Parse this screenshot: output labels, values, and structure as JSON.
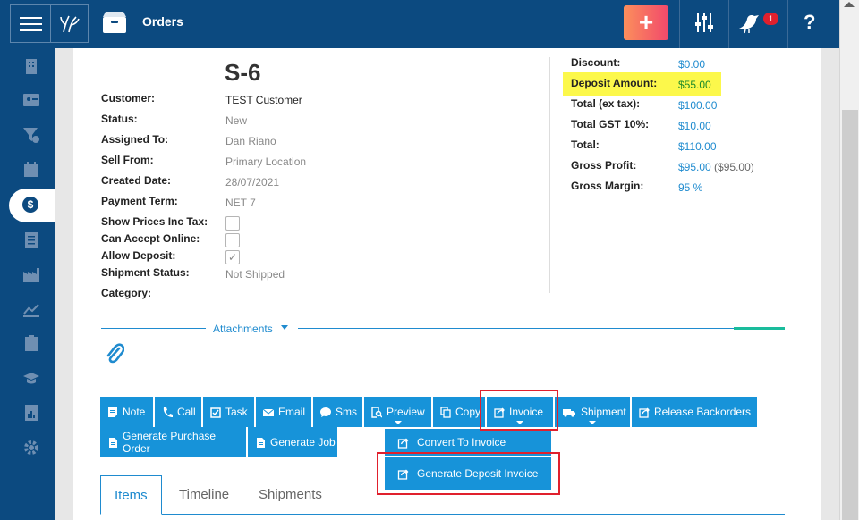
{
  "topbar": {
    "module_title": "Orders",
    "plus_label": "+",
    "notification_count": "1",
    "help_label": "?"
  },
  "order": {
    "number": "S-6",
    "fields": [
      {
        "label": "Customer:",
        "value": "TEST Customer"
      },
      {
        "label": "Status:",
        "value": "New"
      },
      {
        "label": "Assigned To:",
        "value": "Dan Riano"
      },
      {
        "label": "Sell From:",
        "value": "Primary Location"
      },
      {
        "label": "Created Date:",
        "value": "28/07/2021"
      },
      {
        "label": "Payment Term:",
        "value": "NET 7"
      },
      {
        "label": "Show Prices Inc Tax:",
        "value": ""
      },
      {
        "label": "Can Accept Online:",
        "value": ""
      },
      {
        "label": "Allow Deposit:",
        "value": ""
      },
      {
        "label": "Shipment Status:",
        "value": "Not Shipped"
      },
      {
        "label": "Category:",
        "value": ""
      }
    ],
    "checkboxes": {
      "show_prices_inc_tax": false,
      "can_accept_online": false,
      "allow_deposit": true
    }
  },
  "summary": [
    {
      "label": "Discount:",
      "value": "$0.00",
      "extra": ""
    },
    {
      "label": "Deposit Amount:",
      "value": "$55.00",
      "extra": ""
    },
    {
      "label": "Total (ex tax):",
      "value": "$100.00",
      "extra": ""
    },
    {
      "label": "Total GST 10%:",
      "value": "$10.00",
      "extra": ""
    },
    {
      "label": "Total:",
      "value": "$110.00",
      "extra": ""
    },
    {
      "label": "Gross Profit:",
      "value": "$95.00",
      "extra": "($95.00)"
    },
    {
      "label": "Gross Margin:",
      "value": "95 %",
      "extra": ""
    }
  ],
  "attachments": {
    "label": "Attachments"
  },
  "actions": {
    "note": "Note",
    "call": "Call",
    "task": "Task",
    "email": "Email",
    "sms": "Sms",
    "preview": "Preview",
    "copy": "Copy",
    "invoice": "Invoice",
    "shipment": "Shipment",
    "release_backorders": "Release Backorders",
    "generate_purchase_order": "Generate Purchase Order",
    "generate_job": "Generate Job"
  },
  "invoice_menu": {
    "convert_to_invoice": "Convert To Invoice",
    "generate_deposit_invoice": "Generate Deposit Invoice"
  },
  "tabs": [
    "Items",
    "Timeline",
    "Shipments"
  ],
  "colors": {
    "brand_navy": "#0c4a80",
    "action_blue": "#1793d9",
    "highlight_yellow": "#fcf84b",
    "annotation_red": "#e0202d"
  }
}
